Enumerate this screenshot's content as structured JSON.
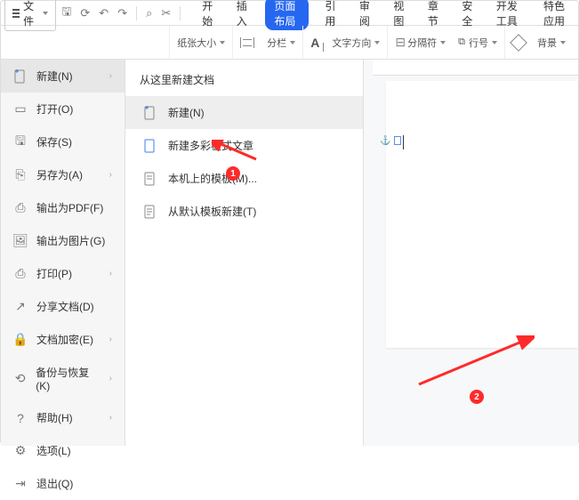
{
  "topbar": {
    "file_button": "文件",
    "tabs": [
      "开始",
      "插入",
      "页面布局",
      "引用",
      "审阅",
      "视图",
      "章节",
      "安全",
      "开发工具",
      "特色应用"
    ],
    "active_tab": "页面布局"
  },
  "ribbon": {
    "paper_size": "纸张大小",
    "columns": "分栏",
    "text_direction": "文字方向",
    "section_break": "分隔符",
    "line_number": "行号",
    "background": "背景"
  },
  "sidebar": [
    {
      "id": "new",
      "label": "新建(N)",
      "interact": true,
      "has_sub": true,
      "icon": "new-doc-icon"
    },
    {
      "id": "open",
      "label": "打开(O)",
      "interact": true,
      "has_sub": false,
      "icon": "folder-icon"
    },
    {
      "id": "save",
      "label": "保存(S)",
      "interact": true,
      "has_sub": false,
      "icon": "save-icon"
    },
    {
      "id": "saveas",
      "label": "另存为(A)",
      "interact": true,
      "has_sub": true,
      "icon": "saveas-icon"
    },
    {
      "id": "pdf",
      "label": "输出为PDF(F)",
      "interact": true,
      "has_sub": false,
      "icon": "pdf-icon"
    },
    {
      "id": "image",
      "label": "输出为图片(G)",
      "interact": true,
      "has_sub": false,
      "icon": "image-icon"
    },
    {
      "id": "print",
      "label": "打印(P)",
      "interact": true,
      "has_sub": true,
      "icon": "print-icon"
    },
    {
      "id": "share",
      "label": "分享文档(D)",
      "interact": true,
      "has_sub": false,
      "icon": "share-icon"
    },
    {
      "id": "encrypt",
      "label": "文档加密(E)",
      "interact": true,
      "has_sub": true,
      "icon": "lock-icon"
    },
    {
      "id": "backup",
      "label": "备份与恢复(K)",
      "interact": true,
      "has_sub": true,
      "icon": "backup-icon"
    },
    {
      "id": "help",
      "label": "帮助(H)",
      "interact": true,
      "has_sub": true,
      "icon": "help-icon"
    },
    {
      "id": "options",
      "label": "选项(L)",
      "interact": true,
      "has_sub": false,
      "icon": "gear-icon"
    },
    {
      "id": "exit",
      "label": "退出(Q)",
      "interact": true,
      "has_sub": false,
      "icon": "exit-icon"
    }
  ],
  "submenu": {
    "title": "从这里新建文档",
    "items": [
      {
        "id": "blank",
        "label": "新建(N)",
        "icon": "new-doc-icon",
        "hover": true
      },
      {
        "id": "colorful",
        "label": "新建多彩板式文章",
        "icon": "color-doc-icon",
        "hover": false
      },
      {
        "id": "local",
        "label": "本机上的模板(M)...",
        "icon": "template-icon",
        "hover": false
      },
      {
        "id": "default",
        "label": "从默认模板新建(T)",
        "icon": "default-template-icon",
        "hover": false
      }
    ]
  },
  "annotation": {
    "badge1": "1",
    "badge2": "2"
  }
}
